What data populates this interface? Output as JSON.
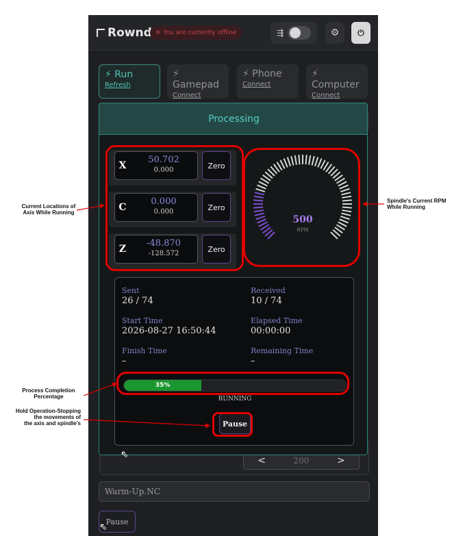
{
  "app": {
    "logo": "Rownd",
    "offline": "You are currently offline"
  },
  "tabs": [
    {
      "title": "Run",
      "sub": "Refresh"
    },
    {
      "title": "Gamepad",
      "sub": "Connect"
    },
    {
      "title": "Phone",
      "sub": "Connect"
    },
    {
      "title": "Computer",
      "sub": "Connect"
    }
  ],
  "modal": {
    "title": "Processing",
    "axes": [
      {
        "letter": "X",
        "value": "50.702",
        "sub": "0.000",
        "button": "Zero"
      },
      {
        "letter": "C",
        "value": "0.000",
        "sub": "0.000",
        "button": "Zero"
      },
      {
        "letter": "Z",
        "value": "-48.870",
        "sub": "-128.572",
        "button": "Zero"
      }
    ],
    "rpm": {
      "value": "500",
      "unit": "RPM",
      "fraction": 0.22
    },
    "info": {
      "sent_label": "Sent",
      "sent": "26 / 74",
      "received_label": "Received",
      "received": "10 / 74",
      "start_label": "Start Time",
      "start": "2026-08-27 16:50:44",
      "elapsed_label": "Elapsed Time",
      "elapsed": "00:00:00",
      "finish_label": "Finish Time",
      "finish": "–",
      "remaining_label": "Remaining Time",
      "remaining": "–"
    },
    "progress": {
      "percent": 35,
      "label": "35%"
    },
    "status": "RUNNING",
    "pause": "Pause"
  },
  "background": {
    "stepper_value": "200",
    "file": "Warm-Up.NC",
    "pause": "Pause"
  },
  "annotations": {
    "axes_l1": "Current Locations of",
    "axes_l2": "Axis While Running",
    "rpm_l1": "Spindle's Current RPM",
    "rpm_l2": "While Running",
    "progress_l1": "Process Completion",
    "progress_l2": "Percentage",
    "hold_l1": "Hold Operation-Stopping",
    "hold_l2": "the movements of",
    "hold_l3": "the axis and spindle's"
  },
  "colors": {
    "accent": "#4ec3b4",
    "progress": "#1c9630",
    "highlight": "#e00000",
    "gauge_active": "#7b4fd1",
    "gauge_idle": "#d8d8d8"
  }
}
